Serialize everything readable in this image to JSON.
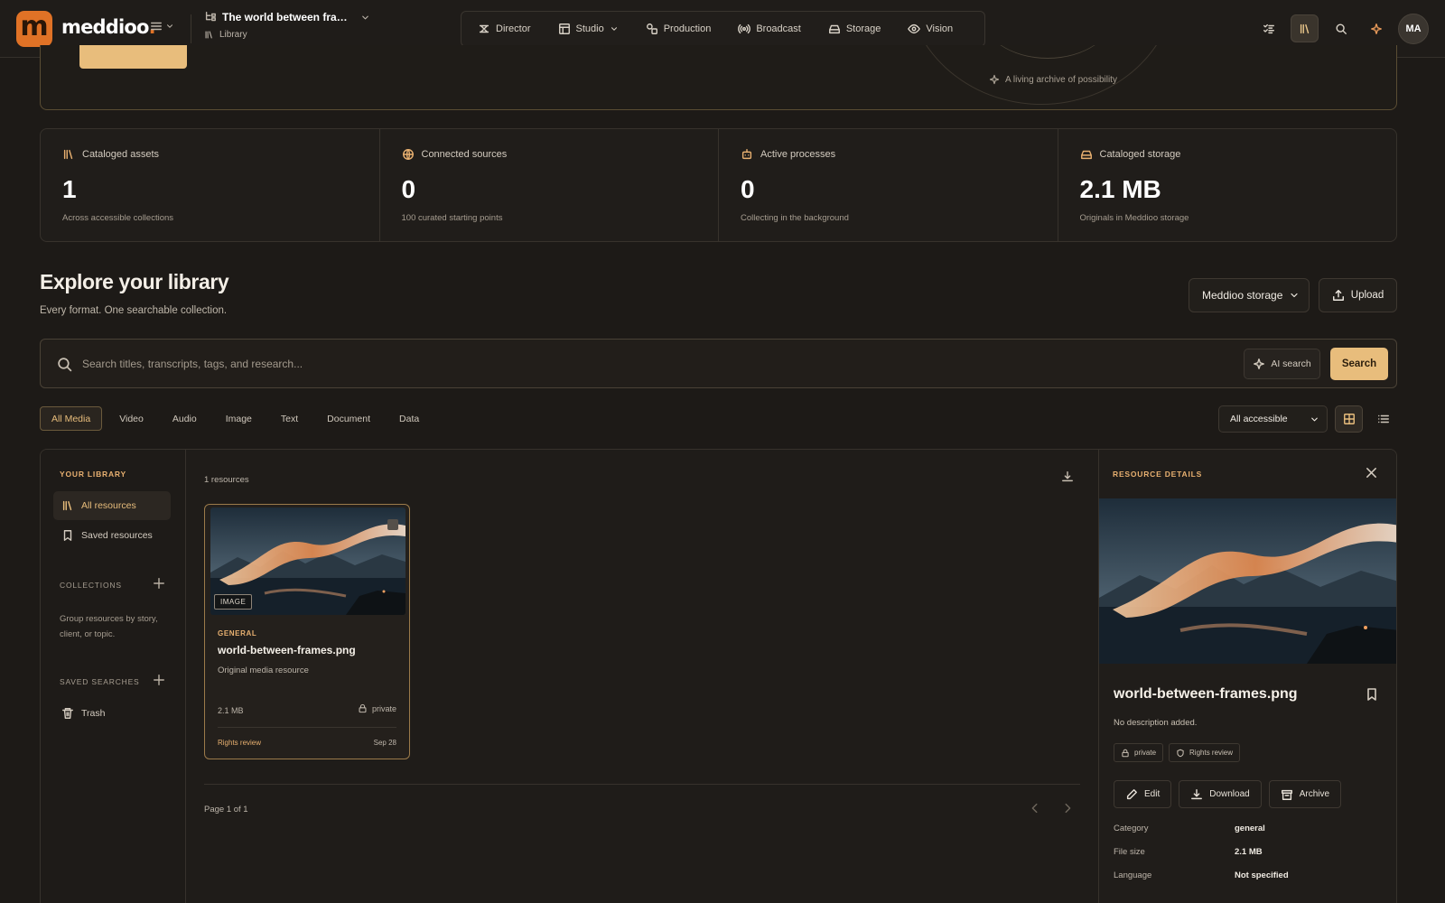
{
  "colors": {
    "accent": "#e8bd7c",
    "brand": "#e07226",
    "background": "#1d1a17"
  },
  "app": {
    "brand_name": "meddioo",
    "brand_dot": ".",
    "logo_letter": "m",
    "project_title": "The world between fra…",
    "project_section": "Library",
    "avatar_initials": "MA"
  },
  "nav": [
    {
      "label": "Director",
      "icon": "director-chair-icon"
    },
    {
      "label": "Studio",
      "icon": "layout-icon"
    },
    {
      "label": "Production",
      "icon": "shapes-icon"
    },
    {
      "label": "Broadcast",
      "icon": "broadcast-icon"
    },
    {
      "label": "Storage",
      "icon": "hard-drive-icon"
    },
    {
      "label": "Vision",
      "icon": "eye-icon"
    }
  ],
  "hero": {
    "tagline": "A living archive of possibility"
  },
  "stats": [
    {
      "label": "Cataloged assets",
      "value": "1",
      "sub": "Across accessible collections",
      "icon": "library-icon"
    },
    {
      "label": "Connected sources",
      "value": "0",
      "sub": "100 curated starting points",
      "icon": "globe-icon"
    },
    {
      "label": "Active processes",
      "value": "0",
      "sub": "Collecting in the background",
      "icon": "bot-icon"
    },
    {
      "label": "Cataloged storage",
      "value": "2.1 MB",
      "sub": "Originals in Meddioo storage",
      "icon": "hard-drive-icon"
    }
  ],
  "explore": {
    "title": "Explore your library",
    "subtitle": "Every format. One searchable collection.",
    "storage_select": "Meddioo storage",
    "upload_label": "Upload"
  },
  "search": {
    "placeholder": "Search titles, transcripts, tags, and research...",
    "value": "",
    "ai_label": "AI search",
    "submit_label": "Search"
  },
  "filters": {
    "tabs": [
      "All Media",
      "Video",
      "Audio",
      "Image",
      "Text",
      "Document",
      "Data"
    ],
    "active": "All Media",
    "access_select": "All accessible"
  },
  "sidebar": {
    "title": "YOUR LIBRARY",
    "items": [
      {
        "label": "All resources",
        "icon": "library-icon"
      },
      {
        "label": "Saved resources",
        "icon": "bookmark-icon"
      }
    ],
    "collections_label": "COLLECTIONS",
    "collections_note": "Group resources by story, client, or topic.",
    "saved_searches_label": "SAVED SEARCHES",
    "trash_label": "Trash"
  },
  "results": {
    "count_label": "1 resources",
    "page_label": "Page 1 of 1",
    "cards": [
      {
        "type_badge": "IMAGE",
        "category": "GENERAL",
        "title": "world-between-frames.png",
        "description": "Original media resource",
        "size": "2.1 MB",
        "visibility": "private",
        "rights": "Rights review",
        "date": "Sep 28"
      }
    ]
  },
  "details": {
    "header": "RESOURCE DETAILS",
    "name": "world-between-frames.png",
    "description": "No description added.",
    "tags": [
      "private",
      "Rights review"
    ],
    "actions": [
      "Edit",
      "Download",
      "Archive"
    ],
    "meta": [
      {
        "key": "Category",
        "value": "general"
      },
      {
        "key": "File size",
        "value": "2.1 MB"
      },
      {
        "key": "Language",
        "value": "Not specified"
      }
    ]
  }
}
